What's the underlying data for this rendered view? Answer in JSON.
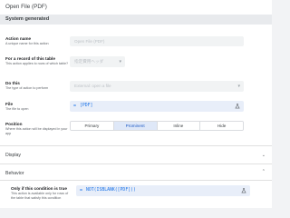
{
  "window": {
    "title": "Open File (PDF)"
  },
  "section": {
    "system_generated": "System generated"
  },
  "action_name": {
    "label": "Action name",
    "description": "A unique name for this action",
    "value": "Open File (PDF)"
  },
  "record_of_table": {
    "label": "For a record of this table",
    "description": "This action applies to rows of which table?",
    "value": "指定費用ヘッダ"
  },
  "do_this": {
    "label": "Do this",
    "description": "The type of action to perform",
    "value": "External: open a file"
  },
  "file": {
    "label": "File",
    "description": "The file to open",
    "expression": "[PDF]"
  },
  "position": {
    "label": "Position",
    "description": "Where this action will be displayed in your app",
    "options": [
      "Primary",
      "Prominent",
      "Inline",
      "Hide"
    ],
    "selected": "Prominent"
  },
  "display": {
    "label": "Display"
  },
  "behavior": {
    "label": "Behavior"
  },
  "condition": {
    "label": "Only if this condition is true",
    "description": "This action is available only for rows of the table that satisfy this condition",
    "expression": "NOT(ISBLANK([PDF]))"
  },
  "icons": {
    "expression_prefix": "=",
    "test_icon": "flask-icon",
    "dropdown_icon": "chevron-down-icon"
  },
  "colors": {
    "accent": "#1a73e8",
    "selected_segment": "#dfe8f8"
  }
}
